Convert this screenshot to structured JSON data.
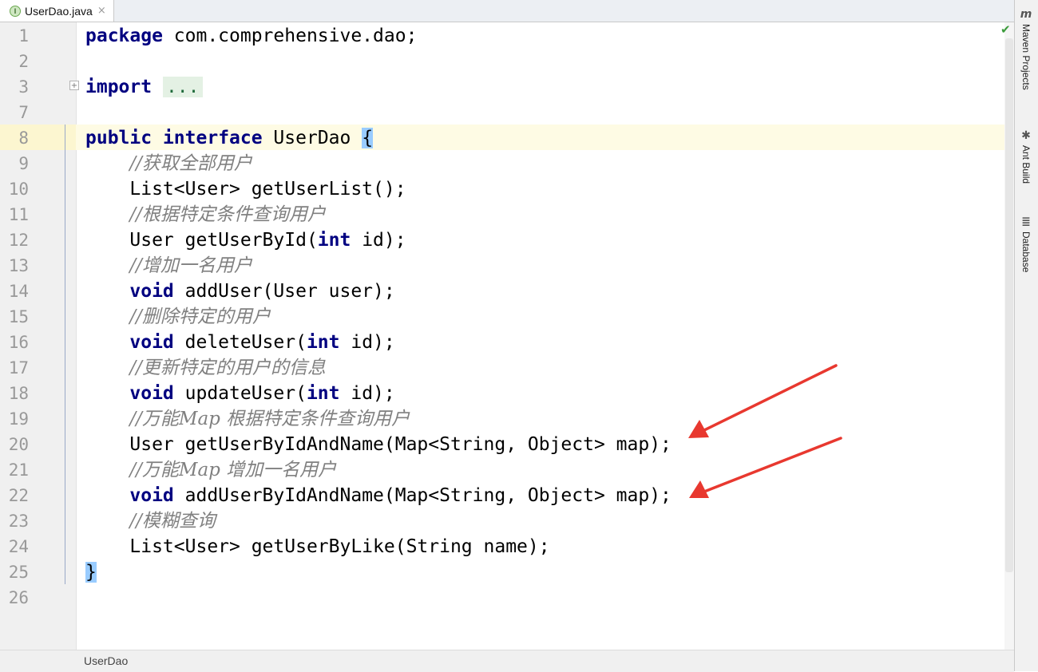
{
  "tab": {
    "filename": "UserDao.java",
    "icon": "I",
    "close": "×"
  },
  "gutter": {
    "fold_toggle": "+"
  },
  "lines": [
    {
      "n": "1",
      "tokens": [
        {
          "t": "package",
          "c": "kw"
        },
        {
          "t": " com.comprehensive.dao;"
        }
      ]
    },
    {
      "n": "2",
      "tokens": []
    },
    {
      "n": "3",
      "tokens": [
        {
          "t": "import",
          "c": "kw"
        },
        {
          "t": " "
        },
        {
          "t": "...",
          "c": "fold"
        }
      ]
    },
    {
      "n": "7",
      "tokens": []
    },
    {
      "n": "8",
      "tokens": [
        {
          "t": "public",
          "c": "kw"
        },
        {
          "t": " "
        },
        {
          "t": "interface",
          "c": "kw"
        },
        {
          "t": " UserDao "
        },
        {
          "t": "{",
          "c": "brace"
        }
      ]
    },
    {
      "n": "9",
      "tokens": [
        {
          "t": "    "
        },
        {
          "t": "//获取全部用户",
          "c": "cm"
        }
      ]
    },
    {
      "n": "10",
      "tokens": [
        {
          "t": "    List<User> getUserList();"
        }
      ]
    },
    {
      "n": "11",
      "tokens": [
        {
          "t": "    "
        },
        {
          "t": "//根据特定条件查询用户",
          "c": "cm"
        }
      ]
    },
    {
      "n": "12",
      "tokens": [
        {
          "t": "    User getUserById("
        },
        {
          "t": "int",
          "c": "kw"
        },
        {
          "t": " id);"
        }
      ]
    },
    {
      "n": "13",
      "tokens": [
        {
          "t": "    "
        },
        {
          "t": "//增加一名用户",
          "c": "cm"
        }
      ]
    },
    {
      "n": "14",
      "tokens": [
        {
          "t": "    "
        },
        {
          "t": "void",
          "c": "kw"
        },
        {
          "t": " addUser(User user);"
        }
      ]
    },
    {
      "n": "15",
      "tokens": [
        {
          "t": "    "
        },
        {
          "t": "//删除特定的用户",
          "c": "cm"
        }
      ]
    },
    {
      "n": "16",
      "tokens": [
        {
          "t": "    "
        },
        {
          "t": "void",
          "c": "kw"
        },
        {
          "t": " deleteUser("
        },
        {
          "t": "int",
          "c": "kw"
        },
        {
          "t": " id);"
        }
      ]
    },
    {
      "n": "17",
      "tokens": [
        {
          "t": "    "
        },
        {
          "t": "//更新特定的用户的信息",
          "c": "cm"
        }
      ]
    },
    {
      "n": "18",
      "tokens": [
        {
          "t": "    "
        },
        {
          "t": "void",
          "c": "kw"
        },
        {
          "t": " updateUser("
        },
        {
          "t": "int",
          "c": "kw"
        },
        {
          "t": " id);"
        }
      ]
    },
    {
      "n": "19",
      "tokens": [
        {
          "t": "    "
        },
        {
          "t": "//万能Map 根据特定条件查询用户",
          "c": "cm"
        }
      ]
    },
    {
      "n": "20",
      "tokens": [
        {
          "t": "    User getUserByIdAndName(Map<String, Object> map);"
        }
      ]
    },
    {
      "n": "21",
      "tokens": [
        {
          "t": "    "
        },
        {
          "t": "//万能Map 增加一名用户",
          "c": "cm"
        }
      ]
    },
    {
      "n": "22",
      "tokens": [
        {
          "t": "    "
        },
        {
          "t": "void",
          "c": "kw"
        },
        {
          "t": " addUserByIdAndName(Map<String, Object> map);"
        }
      ]
    },
    {
      "n": "23",
      "tokens": [
        {
          "t": "    "
        },
        {
          "t": "//模糊查询",
          "c": "cm"
        }
      ]
    },
    {
      "n": "24",
      "tokens": [
        {
          "t": "    List<User> getUserByLike(String name);"
        }
      ]
    },
    {
      "n": "25",
      "tokens": [
        {
          "t": "}",
          "c": "brace"
        }
      ]
    },
    {
      "n": "26",
      "tokens": []
    }
  ],
  "right_tools": [
    {
      "icon": "m",
      "label": "Maven Projects"
    },
    {
      "icon": "✱",
      "label": "Ant Build"
    },
    {
      "icon": "≣",
      "label": "Database"
    }
  ],
  "status": {
    "breadcrumb": "UserDao"
  },
  "colors": {
    "keyword": "#000080",
    "comment": "#808080",
    "arrow": "#e8382f",
    "caret_row": "#fefbe4",
    "brace_match": "#99ccff"
  }
}
